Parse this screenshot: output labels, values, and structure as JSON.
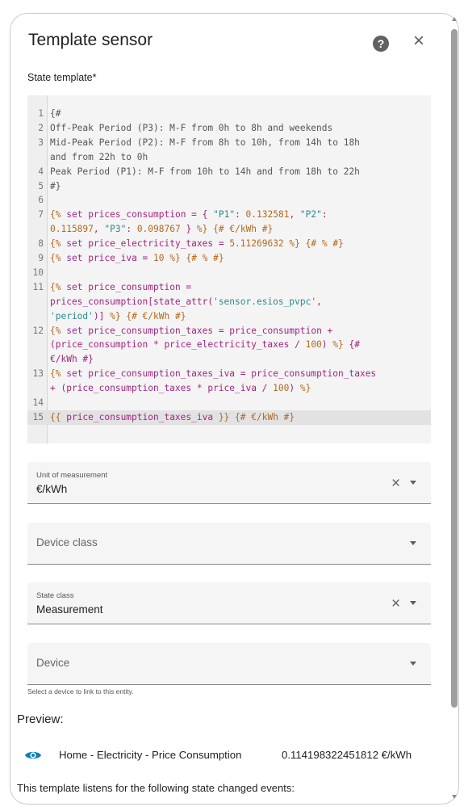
{
  "dialog": {
    "title": "Template sensor",
    "help_icon": "help-circle-icon",
    "close_icon": "close-icon"
  },
  "state_template": {
    "label": "State template*",
    "line_numbers": [
      "1",
      "2",
      "3",
      "",
      "4",
      "5",
      "6",
      "7",
      "",
      "8",
      "9",
      "10",
      "11",
      "",
      "",
      "12",
      "",
      "",
      "13",
      "",
      "14",
      "15"
    ],
    "lines": [
      "{#",
      "Off-Peak Period (P3): M-F from 0h to 8h and weekends",
      "Mid-Peak Period (P2): M-F from 8h to 10h, from 14h to 18h",
      "and from 22h to 0h",
      "Peak Period (P1): M-F from 10h to 14h and from 18h to 22h",
      "#}",
      "",
      "{% set prices_consumption = { \"P1\": 0.132581, \"P2\":",
      "0.115897, \"P3\": 0.098767 } %} {# €/kWh #}",
      "{% set price_electricity_taxes = 5.11269632 %} {# % #}",
      "{% set price_iva = 10 %} {# % #}",
      "",
      "{% set price_consumption =",
      "prices_consumption[state_attr('sensor.esios_pvpc',",
      "'period')] %} {# €/kWh #}",
      "{% set price_consumption_taxes = price_consumption +",
      "(price_consumption * price_electricity_taxes / 100) %} {#",
      "€/kWh #}",
      "{% set price_consumption_taxes_iva = price_consumption_taxes",
      "+ (price_consumption_taxes * price_iva / 100) %}",
      "",
      "{{ price_consumption_taxes_iva }} {# €/kWh #}"
    ]
  },
  "fields": {
    "unit": {
      "label": "Unit of measurement",
      "value": "€/kWh"
    },
    "device_class": {
      "placeholder": "Device class"
    },
    "state_class": {
      "label": "State class",
      "value": "Measurement"
    },
    "device": {
      "placeholder": "Device",
      "helper": "Select a device to link to this entity."
    }
  },
  "preview": {
    "title": "Preview:",
    "icon": "eye-icon",
    "entity_name": "Home - Electricity - Price Consumption",
    "entity_state": "0.114198322451812 €/kWh",
    "listen_text": "This template listens for the following state changed events:"
  },
  "colors": {
    "accent": "#03a9f4",
    "keyword": "#9a2c8f",
    "string": "#2b8a8a",
    "number": "#b5681c"
  }
}
